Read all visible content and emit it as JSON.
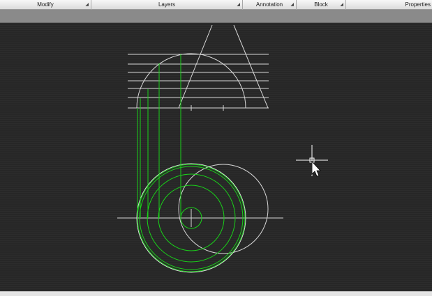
{
  "ribbon": {
    "panels": [
      {
        "label": "Modify"
      },
      {
        "label": "Layers"
      },
      {
        "label": "Annotation"
      },
      {
        "label": "Block"
      },
      {
        "label": "Properties"
      }
    ]
  },
  "colors": {
    "canvas": "#272727",
    "geometry_white": "#d8d8d8",
    "geometry_green": "#19d219"
  },
  "icons": {
    "crosshair": "crosshair-cursor-icon",
    "pointer": "arrow-pointer-icon",
    "dropdown": "dropdown-arrow-icon"
  }
}
